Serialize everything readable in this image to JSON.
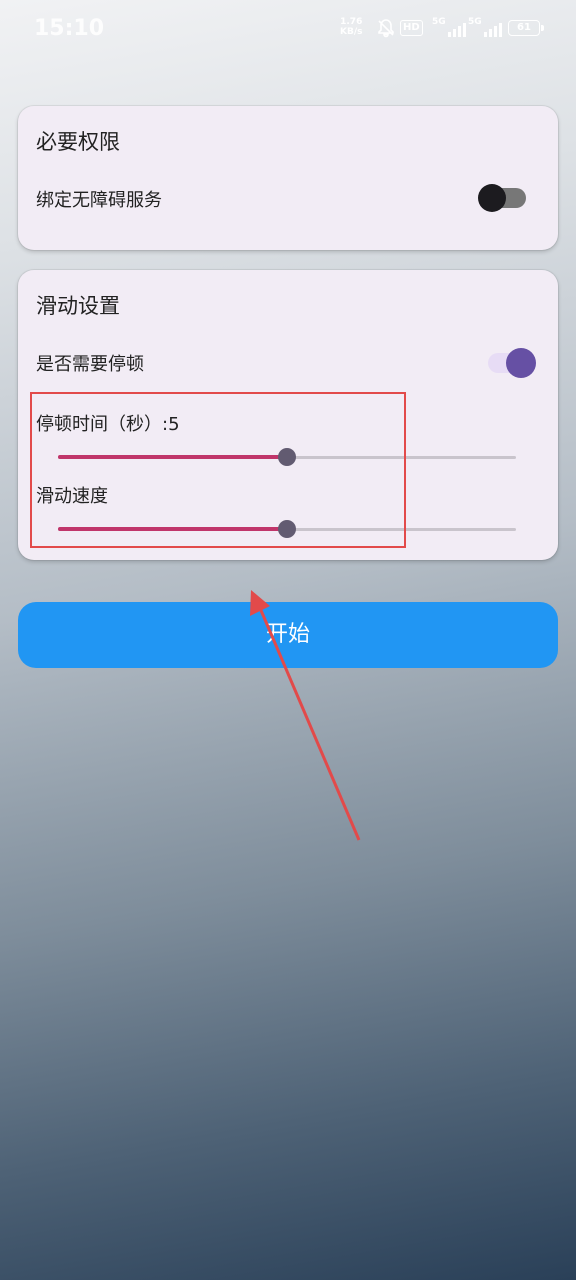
{
  "status_bar": {
    "time": "15:10",
    "net_speed_value": "1.76",
    "net_speed_unit": "KB/s",
    "hd_label": "HD",
    "sim1_label": "5G",
    "sim2_label": "5G",
    "battery": "61",
    "icons": [
      "bell-mute-icon",
      "signal-icon",
      "battery-icon"
    ]
  },
  "permissions_card": {
    "title": "必要权限",
    "accessibility_label": "绑定无障碍服务",
    "accessibility_enabled": false
  },
  "slide_card": {
    "title": "滑动设置",
    "pause_label": "是否需要停顿",
    "pause_enabled": true,
    "pause_time_label": "停顿时间（秒）:5",
    "pause_time_level": 0.5,
    "speed_label": "滑动速度",
    "speed_level": 0.5
  },
  "start_button": {
    "label": "开始"
  },
  "colors": {
    "accent": "#6650a4",
    "slider_fill": "#c0356a",
    "button": "#2196f3",
    "annotation": "#e24a4a",
    "card_bg": "#f2ecf5"
  }
}
